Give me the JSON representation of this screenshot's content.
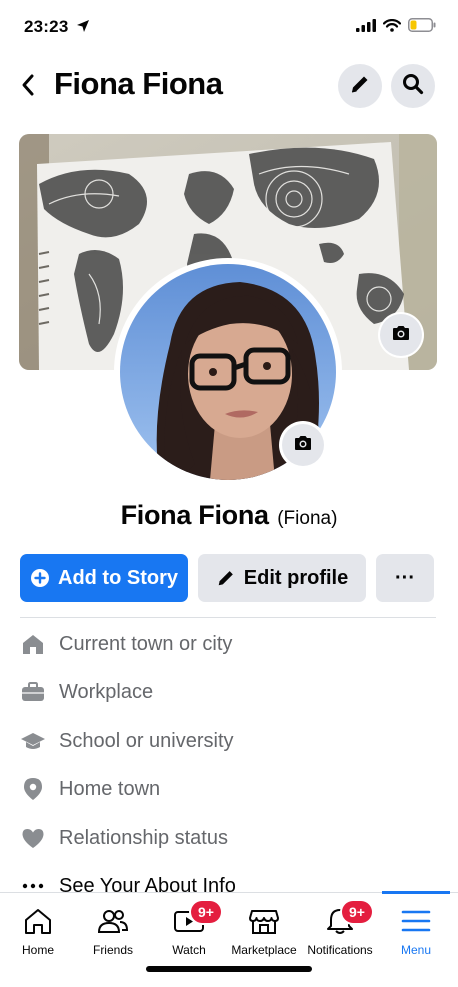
{
  "status_bar": {
    "time": "23:23"
  },
  "header": {
    "title": "Fiona Fiona"
  },
  "profile": {
    "name": "Fiona Fiona",
    "alt_name": "(Fiona)"
  },
  "actions": {
    "add_story": "Add to Story",
    "edit_profile": "Edit profile",
    "more": "···"
  },
  "about": {
    "items": [
      {
        "label": "Current town or city",
        "icon": "house-icon"
      },
      {
        "label": "Workplace",
        "icon": "briefcase-icon"
      },
      {
        "label": "School or university",
        "icon": "graduation-cap-icon"
      },
      {
        "label": "Home town",
        "icon": "location-pin-icon"
      },
      {
        "label": "Relationship status",
        "icon": "heart-icon"
      },
      {
        "label": "See Your About Info",
        "icon": "ellipsis-icon"
      }
    ]
  },
  "tabbar": {
    "tabs": [
      {
        "label": "Home",
        "icon": "home-icon"
      },
      {
        "label": "Friends",
        "icon": "friends-icon"
      },
      {
        "label": "Watch",
        "icon": "watch-icon",
        "badge": "9+"
      },
      {
        "label": "Marketplace",
        "icon": "marketplace-icon"
      },
      {
        "label": "Notifications",
        "icon": "bell-icon",
        "badge": "9+"
      },
      {
        "label": "Menu",
        "icon": "menu-icon",
        "active": true
      }
    ]
  },
  "colors": {
    "primary": "#1877f2",
    "badge": "#e41e3f",
    "secondary_button": "#e4e6eb",
    "muted_text": "#65676b"
  }
}
